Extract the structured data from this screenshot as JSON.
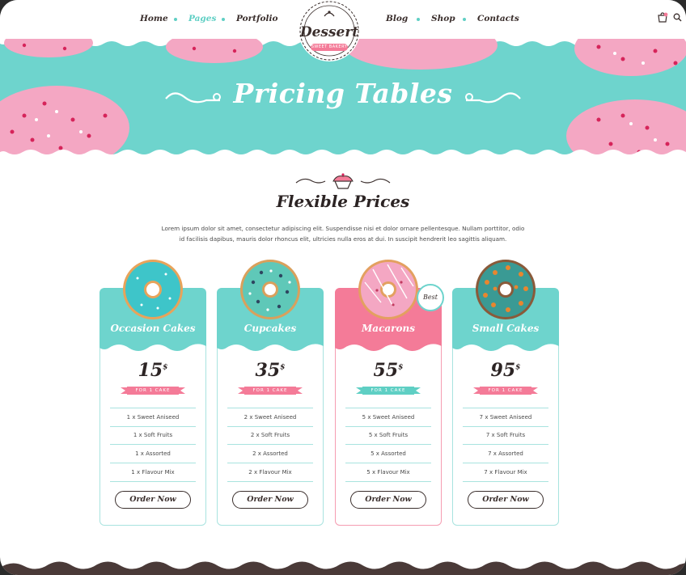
{
  "nav": {
    "left": [
      "Home",
      "Pages",
      "Portfolio"
    ],
    "right": [
      "Blog",
      "Shop",
      "Contacts"
    ],
    "active": "Pages"
  },
  "logo": {
    "word": "Dessert",
    "subtitle": "SWEET BAKERY"
  },
  "hero": {
    "title": "Pricing Tables"
  },
  "section": {
    "title": "Flexible Prices",
    "desc_line1": "Lorem ipsum dolor sit amet, consectetur adipiscing elit. Suspendisse nisi et dolor ornare pellentesque. Nullam porttitor, odio",
    "desc_line2": "id facilisis dapibus, mauris dolor rhoncus elit, ultricies nulla eros at dui. In suscipit hendrerit leo sagittis aliquam."
  },
  "colors": {
    "teal": "#6ed4cd",
    "pink": "#f47b98",
    "dark": "#3a2e2c",
    "card_border": "#a8e3df"
  },
  "cards": [
    {
      "name": "Occasion Cakes",
      "price": "15",
      "currency": "$",
      "ribbon": "FOR 1 CAKE",
      "features": [
        "1 x Sweet Aniseed",
        "1 x Soft Fruits",
        "1 x Assorted",
        "1 x Flavour Mix"
      ],
      "button": "Order Now"
    },
    {
      "name": "Cupcakes",
      "price": "35",
      "currency": "$",
      "ribbon": "FOR 1 CAKE",
      "features": [
        "2 x Sweet Aniseed",
        "2 x Soft Fruits",
        "2 x Assorted",
        "2 x Flavour Mix"
      ],
      "button": "Order Now"
    },
    {
      "name": "Macarons",
      "price": "55",
      "currency": "$",
      "ribbon": "FOR 1 CAKE",
      "badge": "Best",
      "features": [
        "5 x Sweet Aniseed",
        "5 x Soft Fruits",
        "5 x Assorted",
        "5 x Flavour Mix"
      ],
      "button": "Order Now"
    },
    {
      "name": "Small Cakes",
      "price": "95",
      "currency": "$",
      "ribbon": "FOR 1 CAKE",
      "features": [
        "7 x Sweet Aniseed",
        "7 x Soft Fruits",
        "7 x Assorted",
        "7 x Flavour Mix"
      ],
      "button": "Order Now"
    }
  ]
}
